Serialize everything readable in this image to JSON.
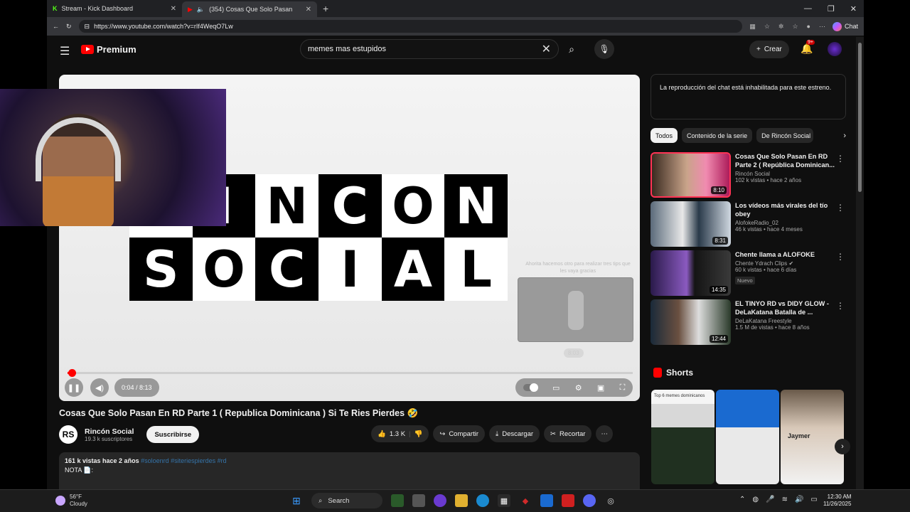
{
  "browser": {
    "tabs": [
      {
        "title": "Stream - Kick Dashboard",
        "active": false
      },
      {
        "title": "(354) Cosas Que Solo Pasan",
        "active": true
      }
    ],
    "url": "https://www.youtube.com/watch?v=rIf4WeqO7Lw",
    "chat_label": "Chat"
  },
  "yt": {
    "logo_text": "Premium",
    "search_value": "memes mas estupidos",
    "create_label": "Crear",
    "notif_badge": "9+"
  },
  "video": {
    "brand_letters": [
      [
        "R",
        "I",
        "N",
        "C",
        "O",
        "N"
      ],
      [
        "S",
        "O",
        "C",
        "I",
        "A",
        "L"
      ]
    ],
    "endcard_text": "Ahorita hacemos otro para realizar tres tips que les vaya gracias",
    "endcard_duration": "8:03",
    "time": "0:04 / 8:13",
    "progress": 0.008,
    "title": "Cosas Que Solo Pasan En RD Parte 1 ( Republica Dominicana ) Si Te Ries Pierdes 🤣",
    "channel": "Rincón Social",
    "subs": "19.3 k suscriptores",
    "subscribe_label": "Suscribirse",
    "likes": "1.3 K",
    "share_label": "Compartir",
    "download_label": "Descargar",
    "clip_label": "Recortar",
    "views_date": "161 k vistas  hace 2 años",
    "tags": "#soloenrd #siteriespierdes #rd",
    "note": "NOTA 📄:"
  },
  "sidebar": {
    "chat_notice": "La reproducción del chat está inhabilitada para este estreno.",
    "chips": [
      "Todos",
      "Contenido de la serie",
      "De Rincón Social"
    ],
    "recs": [
      {
        "title": "Cosas Que Solo Pasan En RD Parte 2 ( República Dominican...",
        "channel": "Rincón Social",
        "meta": "102 k vistas • hace 2 años",
        "duration": "8:10",
        "badge": ""
      },
      {
        "title": "Los vídeos más virales del tío obey",
        "channel": "AlofokeRadio_02",
        "meta": "46 k vistas • hace 4 meses",
        "duration": "8:31",
        "badge": ""
      },
      {
        "title": "Chente llama a ALOFOKE",
        "channel": "Chente Ydrach Clips ✔",
        "meta": "60 k vistas • hace 6 días",
        "duration": "14:35",
        "badge": "Nuevo"
      },
      {
        "title": "EL TINYO RD vs DIDY GLOW - DeLaKatana Batalla de ...",
        "channel": "DeLaKatana Freestyle",
        "meta": "1.5 M de vistas • hace 8 años",
        "duration": "12:44",
        "badge": ""
      }
    ],
    "shorts_label": "Shorts",
    "shorts": [
      {
        "caption": "Top 6 memes dominicanos"
      },
      {
        "caption": ""
      },
      {
        "caption": "Jaymer"
      }
    ]
  },
  "taskbar": {
    "temp": "56°F",
    "weather": "Cloudy",
    "search": "Search",
    "time": "12:30 AM",
    "date": "11/26/2025"
  },
  "colors": {
    "accent": "#ff0000",
    "bg": "#0f0f0f",
    "link": "#3ea6ff"
  }
}
